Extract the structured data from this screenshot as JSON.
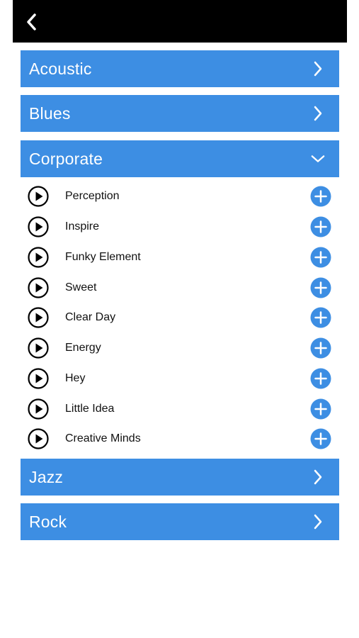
{
  "header": {
    "back_icon": "chevron-left-icon"
  },
  "categories": [
    {
      "label": "Acoustic",
      "state": "collapsed"
    },
    {
      "label": "Blues",
      "state": "collapsed"
    },
    {
      "label": "Corporate",
      "state": "expanded"
    },
    {
      "label": "Jazz",
      "state": "collapsed"
    },
    {
      "label": "Rock",
      "state": "collapsed"
    }
  ],
  "tracks": [
    {
      "name": "Perception"
    },
    {
      "name": "Inspire"
    },
    {
      "name": "Funky Element"
    },
    {
      "name": "Sweet"
    },
    {
      "name": "Clear Day"
    },
    {
      "name": "Energy"
    },
    {
      "name": "Hey"
    },
    {
      "name": "Little Idea"
    },
    {
      "name": "Creative Minds"
    }
  ],
  "colors": {
    "accent": "#3d8ee3",
    "topbar": "#000000",
    "text": "#111111"
  },
  "icons": {
    "play": "play-circle-icon",
    "add": "plus-circle-icon"
  }
}
